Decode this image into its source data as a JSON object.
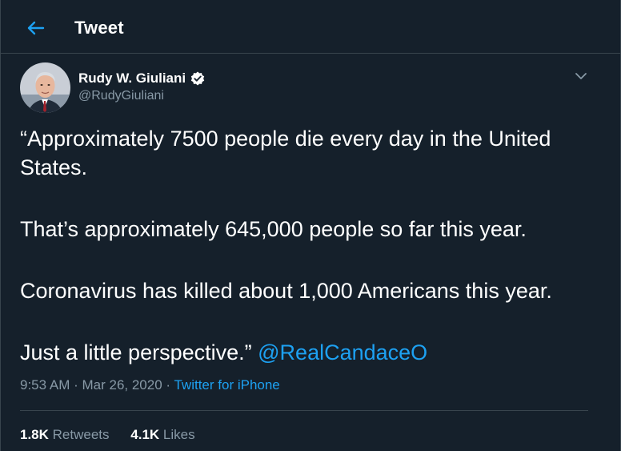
{
  "header": {
    "title": "Tweet",
    "back_icon": "arrow-left-icon"
  },
  "author": {
    "name": "Rudy W. Giuliani",
    "handle": "@RudyGiuliani",
    "verified_icon": "verified-badge-icon",
    "avatar": "avatar-photo"
  },
  "tweet": {
    "paragraphs": [
      "“Approximately 7500 people die every day in the United States.",
      "That’s approximately 645,000 people so far this year.",
      "Coronavirus has killed about 1,000 Americans this year.",
      "Just a little perspective.”"
    ],
    "mention": "@RealCandaceO"
  },
  "meta": {
    "time": "9:53 AM",
    "separator": " · ",
    "date": "Mar 26, 2020",
    "source": "Twitter for iPhone"
  },
  "stats": {
    "retweets_count": "1.8K",
    "retweets_label": "Retweets",
    "likes_count": "4.1K",
    "likes_label": "Likes"
  },
  "colors": {
    "background": "#15202b",
    "accent": "#1da1f2",
    "secondary_text": "#8899a6",
    "border": "#38444d"
  }
}
